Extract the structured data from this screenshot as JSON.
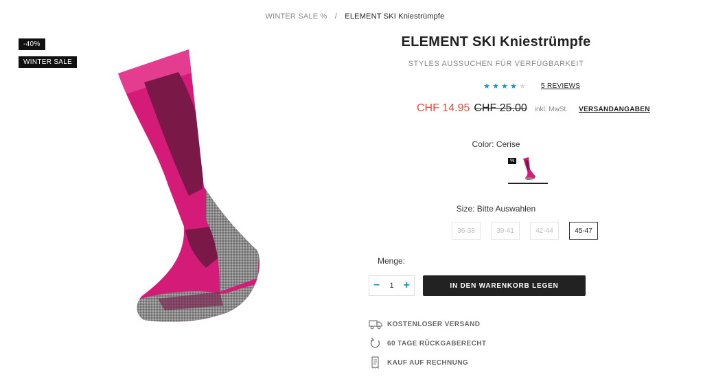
{
  "breadcrumb": {
    "parent": "WINTER SALE %",
    "separator": "/",
    "current": "ELEMENT SKI Kniestrümpfe"
  },
  "badges": {
    "discount": "-40%",
    "sale": "WINTER SALE"
  },
  "product": {
    "title": "ELEMENT SKI Kniestrümpfe",
    "subtitle": "STYLES AUSSUCHEN FÜR VERFÜGBARKEIT",
    "rating": 4,
    "rating_max": 5,
    "reviews_label": "5 REVIEWS",
    "price_now": "CHF 14.95",
    "price_old": "CHF 25.00",
    "vat_note": "inkl. MwSt.",
    "shipping_link": "VERSANDANGABEN"
  },
  "color": {
    "label": "Color: Cerise",
    "swatch_badge": "%",
    "sock_main": "#d41b78",
    "sock_dark": "#7a1848",
    "sock_grey": "#8c8c8c"
  },
  "size": {
    "label": "Size: Bitte Auswahlen",
    "options": [
      {
        "label": "36-38",
        "available": false
      },
      {
        "label": "39-41",
        "available": false
      },
      {
        "label": "42-44",
        "available": false
      },
      {
        "label": "45-47",
        "available": true
      }
    ]
  },
  "quantity": {
    "label": "Menge:",
    "minus": "−",
    "value": "1",
    "plus": "+"
  },
  "cart_button": "IN DEN WARENKORB LEGEN",
  "usps": [
    {
      "icon": "truck-icon",
      "label": "KOSTENLOSER VERSAND"
    },
    {
      "icon": "return-arrow-icon",
      "label": "60 TAGE RÜCKGABERECHT"
    },
    {
      "icon": "receipt-icon",
      "label": "KAUF AUF RECHNUNG"
    }
  ],
  "accent_color": "#1b90c8",
  "sale_price_color": "#e74c3c"
}
